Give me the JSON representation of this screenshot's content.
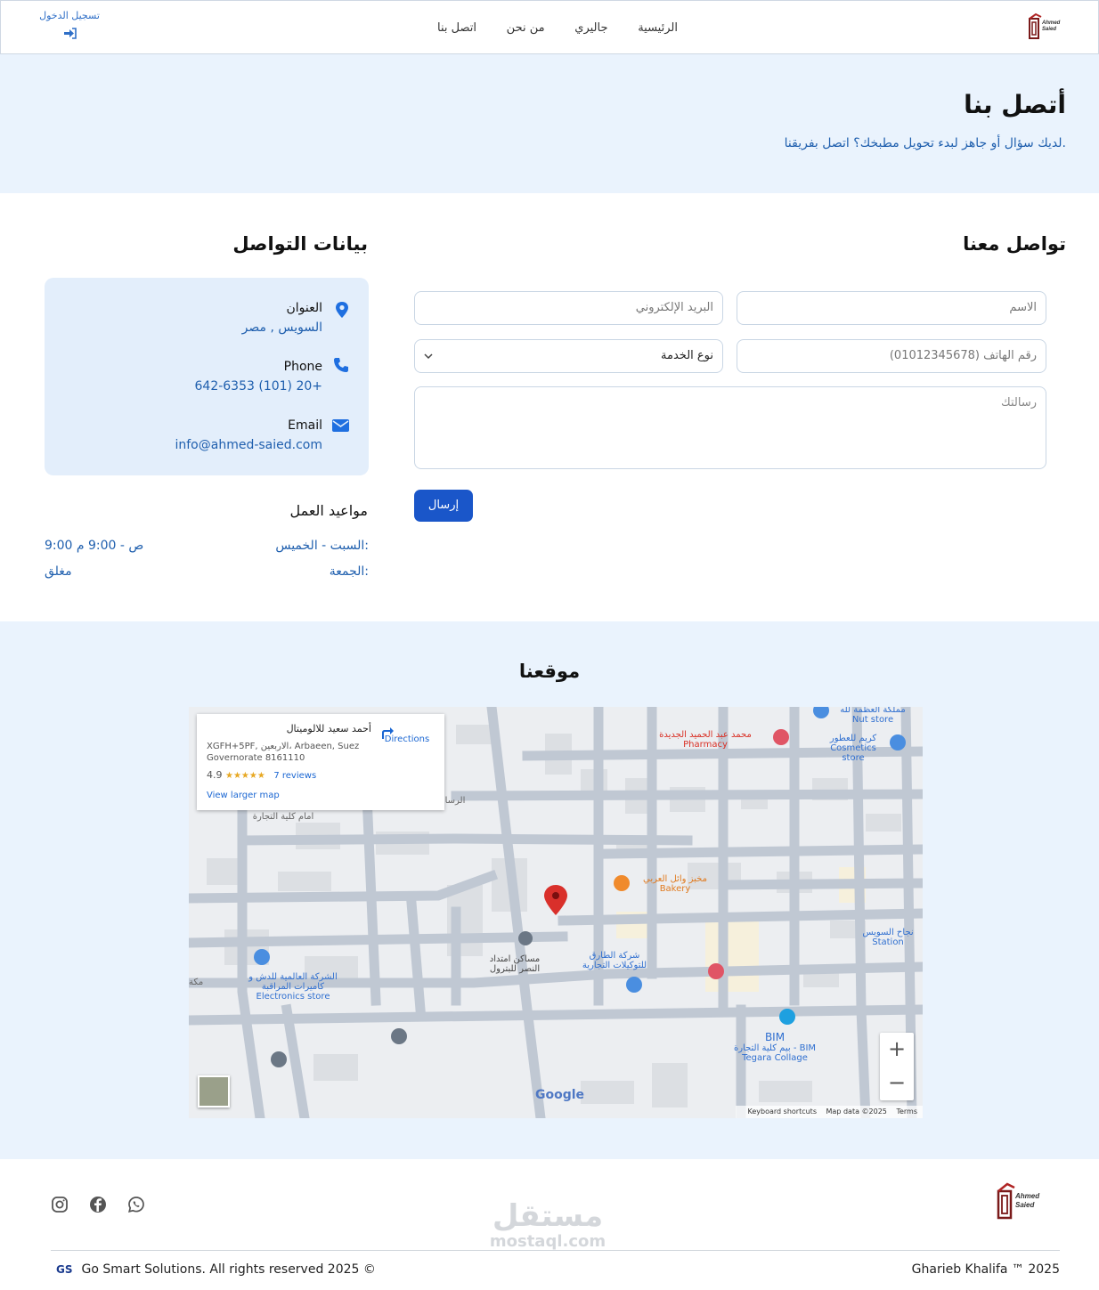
{
  "nav": {
    "brand_lines": [
      "Ahmed",
      "Saied"
    ],
    "links": [
      "الرئيسية",
      "جاليري",
      "من نحن",
      "اتصل بنا"
    ],
    "login_label": "تسجيل الدخول"
  },
  "hero": {
    "title": "أتصل بنا",
    "subtitle": "لديك سؤال أو جاهز لبدء تحويل مطبخك؟ اتصل بفريقنا."
  },
  "form": {
    "title": "تواصل معنا",
    "name_placeholder": "الاسم",
    "email_placeholder": "البريد الإلكتروني",
    "phone_placeholder": "رقم الهاتف (01012345678)",
    "service_select": "نوع الخدمة",
    "message_placeholder": "رسالتك",
    "submit_label": "إرسال"
  },
  "info": {
    "title": "بيانات التواصل",
    "address_label": "العنوان",
    "address_value": "السويس , مصر",
    "phone_label": "Phone",
    "phone_value": "642-6353 (101) 20+",
    "email_label": "Email",
    "email_value": "info@ahmed-saied.com"
  },
  "hours": {
    "title": "مواعيد العمل",
    "rows": [
      {
        "day": "السبت - الخميس:",
        "time": "9:00 ص - 9:00 م"
      },
      {
        "day": "الجمعة:",
        "time": "مغلق"
      }
    ]
  },
  "location": {
    "title": "موقعنا",
    "card": {
      "place_name": "أحمد سعيد للالوميتال",
      "address": "XGFH+5PF, الاربعين، Arbaeen, Suez Governorate 8161110",
      "rating": "4.9",
      "stars": "★★★★★",
      "reviews": "7 reviews",
      "view_larger": "View larger map",
      "directions": "Directions"
    },
    "labels": {
      "pharmacy_name": "محمد عبد الحميد الجديدة",
      "pharmacy_type": "Pharmacy",
      "cosmetics_name": "كريم للعطور",
      "cosmetics_type": "Cosmetics store",
      "nut_name": "مملكة العظمة لله",
      "nut_type": "Nut store",
      "bakery_name": "مخبز وائل العربي",
      "bakery_type": "Bakery",
      "petroleum_name": "مساكن امتداد النصر للبترول",
      "tariq_name": "شركة الطارق للتوكيلات التجارية",
      "electronics_name": "الشركة العالمية للدش و كاميرات المراقبة",
      "electronics_type": "Electronics store",
      "station_name": "نجاح السويس",
      "station_type": "Station",
      "bim_name": "BIM",
      "bim_sub": "بيم كلية التجارة - BIM Tegara Collage",
      "commerce_label": "امام كلية التجارة",
      "rasa_label": "الرسا",
      "edge_left": "مكة"
    },
    "google": "Google",
    "footer_links": [
      "Keyboard shortcuts",
      "Map data ©2025",
      "Terms"
    ]
  },
  "footer": {
    "watermark_ar": "مستقل",
    "watermark_en": "mostaql.com",
    "copyright": "Go Smart Solutions. All rights reserved 2025 ©",
    "copyright_logo": "GS",
    "credit": "Gharieb Khalifa ™ 2025",
    "social_icons": [
      "instagram-icon",
      "facebook-icon",
      "whatsapp-icon"
    ]
  },
  "colors": {
    "accent": "#1a56c9",
    "link": "#1f5fae",
    "hero_bg": "#eaf3fd",
    "info_bg": "#e3eefb"
  }
}
